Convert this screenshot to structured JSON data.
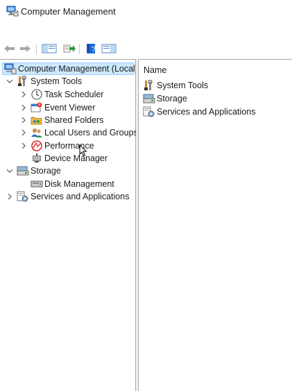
{
  "window": {
    "title": "Computer Management"
  },
  "toolbar": {
    "buttons": [
      {
        "icon": "back-arrow-icon"
      },
      {
        "icon": "forward-arrow-icon"
      },
      {
        "icon": "show-hide-console-tree-icon"
      },
      {
        "icon": "export-list-icon"
      },
      {
        "icon": "help-icon"
      },
      {
        "icon": "show-hide-action-pane-icon"
      }
    ]
  },
  "tree": {
    "root": {
      "label": "Computer Management (Local)",
      "icon": "computer-management-icon",
      "selected": true
    },
    "items": [
      {
        "label": "System Tools",
        "icon": "system-tools-icon",
        "expander": "expanded"
      },
      {
        "label": "Task Scheduler",
        "icon": "clock-icon",
        "expander": "collapsed"
      },
      {
        "label": "Event Viewer",
        "icon": "event-viewer-icon",
        "expander": "collapsed"
      },
      {
        "label": "Shared Folders",
        "icon": "shared-folders-icon",
        "expander": "collapsed"
      },
      {
        "label": "Local Users and Groups",
        "icon": "users-icon",
        "expander": "collapsed"
      },
      {
        "label": "Performance",
        "icon": "performance-icon",
        "expander": "collapsed"
      },
      {
        "label": "Device Manager",
        "icon": "device-manager-icon",
        "expander": "none"
      },
      {
        "label": "Storage",
        "icon": "storage-icon",
        "expander": "expanded"
      },
      {
        "label": "Disk Management",
        "icon": "disk-icon",
        "expander": "none"
      },
      {
        "label": "Services and Applications",
        "icon": "services-icon",
        "expander": "collapsed"
      }
    ]
  },
  "list": {
    "column_header": "Name",
    "items": [
      {
        "label": "System Tools",
        "icon": "system-tools-icon"
      },
      {
        "label": "Storage",
        "icon": "storage-icon"
      },
      {
        "label": "Services and Applications",
        "icon": "services-icon"
      }
    ]
  },
  "colors": {
    "selection_bg": "#cce8ff",
    "selection_border": "#99d1ff",
    "accent": "#1e6bd6"
  }
}
